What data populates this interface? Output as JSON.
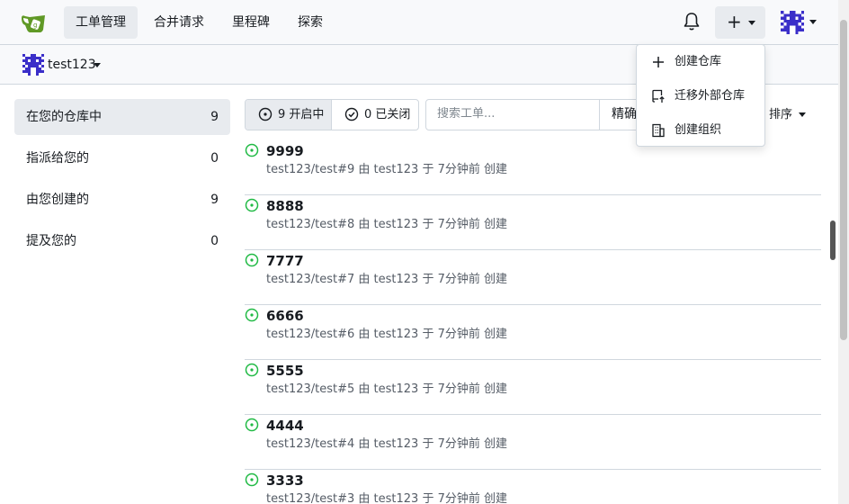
{
  "nav": {
    "items": [
      {
        "label": "工单管理",
        "active": true
      },
      {
        "label": "合并请求",
        "active": false
      },
      {
        "label": "里程碑",
        "active": false
      },
      {
        "label": "探索",
        "active": false
      }
    ],
    "plus_label": "+"
  },
  "context": {
    "name": "test123"
  },
  "sidebar": {
    "items": [
      {
        "label": "在您的仓库中",
        "count": "9",
        "active": true
      },
      {
        "label": "指派给您的",
        "count": "0",
        "active": false
      },
      {
        "label": "由您创建的",
        "count": "9",
        "active": false
      },
      {
        "label": "提及您的",
        "count": "0",
        "active": false
      }
    ]
  },
  "filters": {
    "open_label": "9 开启中",
    "closed_label": "0 已关闭",
    "search_placeholder": "搜索工单...",
    "search_mode": "精确",
    "sort_label": "排序"
  },
  "issues": [
    {
      "title": "9999",
      "meta": "test123/test#9 由 test123 于 7分钟前 创建"
    },
    {
      "title": "8888",
      "meta": "test123/test#8 由 test123 于 7分钟前 创建"
    },
    {
      "title": "7777",
      "meta": "test123/test#7 由 test123 于 7分钟前 创建"
    },
    {
      "title": "6666",
      "meta": "test123/test#6 由 test123 于 7分钟前 创建"
    },
    {
      "title": "5555",
      "meta": "test123/test#5 由 test123 于 7分钟前 创建"
    },
    {
      "title": "4444",
      "meta": "test123/test#4 由 test123 于 7分钟前 创建"
    },
    {
      "title": "3333",
      "meta": "test123/test#3 由 test123 于 7分钟前 创建"
    }
  ],
  "create_menu": {
    "items": [
      {
        "label": "创建仓库",
        "icon": "plus-icon"
      },
      {
        "label": "迁移外部仓库",
        "icon": "repo-push-icon"
      },
      {
        "label": "创建组织",
        "icon": "organization-icon"
      }
    ]
  },
  "colors": {
    "open": "#21ba45",
    "accent": "#4183c4"
  }
}
